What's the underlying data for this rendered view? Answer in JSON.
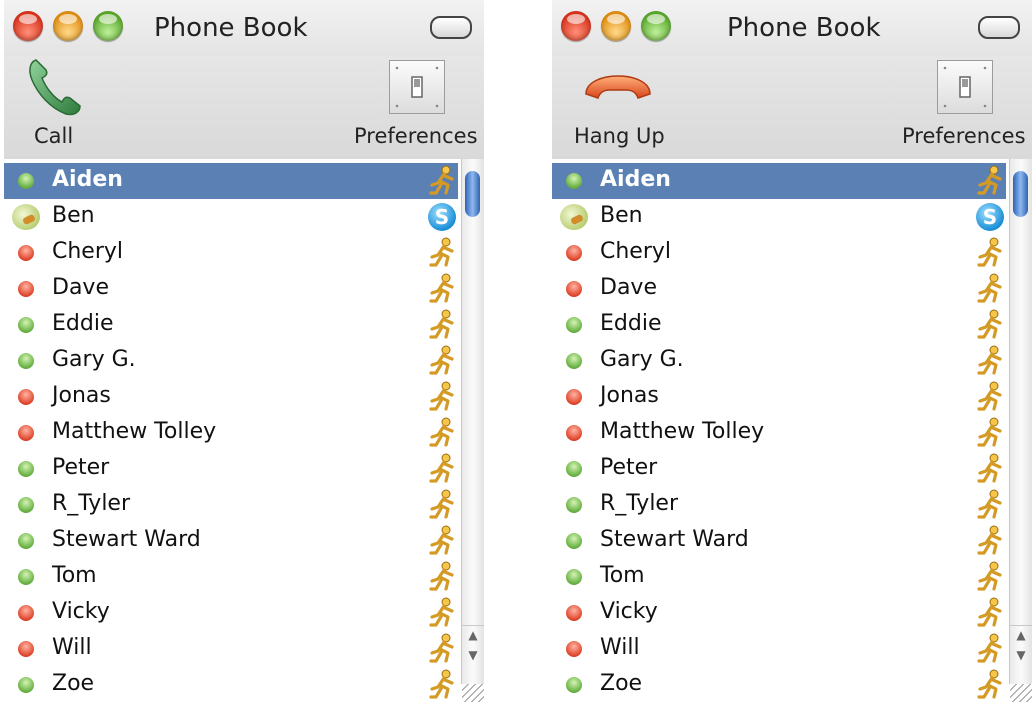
{
  "windows": [
    {
      "title": "Phone Book",
      "call_label": "Call",
      "call_icon": "phone-handset-icon",
      "preferences_label": "Preferences",
      "contacts": [
        {
          "name": "Aiden",
          "status": "green",
          "service": "aim",
          "selected": true
        },
        {
          "name": "Ben",
          "status": "phone",
          "service": "skype"
        },
        {
          "name": "Cheryl",
          "status": "red",
          "service": "aim"
        },
        {
          "name": "Dave",
          "status": "red",
          "service": "aim"
        },
        {
          "name": "Eddie",
          "status": "green",
          "service": "aim"
        },
        {
          "name": "Gary G.",
          "status": "green",
          "service": "aim"
        },
        {
          "name": "Jonas",
          "status": "red",
          "service": "aim"
        },
        {
          "name": "Matthew Tolley",
          "status": "red",
          "service": "aim"
        },
        {
          "name": "Peter",
          "status": "green",
          "service": "aim"
        },
        {
          "name": "R_Tyler",
          "status": "green",
          "service": "aim"
        },
        {
          "name": "Stewart Ward",
          "status": "green",
          "service": "aim"
        },
        {
          "name": "Tom",
          "status": "green",
          "service": "aim"
        },
        {
          "name": "Vicky",
          "status": "red",
          "service": "aim"
        },
        {
          "name": "Will",
          "status": "red",
          "service": "aim"
        },
        {
          "name": "Zoe",
          "status": "green",
          "service": "aim"
        }
      ]
    },
    {
      "title": "Phone Book",
      "call_label": "Hang Up",
      "call_icon": "hang-up-icon",
      "preferences_label": "Preferences",
      "contacts": [
        {
          "name": "Aiden",
          "status": "green",
          "service": "aim",
          "selected": true
        },
        {
          "name": "Ben",
          "status": "phone",
          "service": "skype"
        },
        {
          "name": "Cheryl",
          "status": "red",
          "service": "aim"
        },
        {
          "name": "Dave",
          "status": "red",
          "service": "aim"
        },
        {
          "name": "Eddie",
          "status": "green",
          "service": "aim"
        },
        {
          "name": "Gary G.",
          "status": "green",
          "service": "aim"
        },
        {
          "name": "Jonas",
          "status": "red",
          "service": "aim"
        },
        {
          "name": "Matthew Tolley",
          "status": "red",
          "service": "aim"
        },
        {
          "name": "Peter",
          "status": "green",
          "service": "aim"
        },
        {
          "name": "R_Tyler",
          "status": "green",
          "service": "aim"
        },
        {
          "name": "Stewart Ward",
          "status": "green",
          "service": "aim"
        },
        {
          "name": "Tom",
          "status": "green",
          "service": "aim"
        },
        {
          "name": "Vicky",
          "status": "red",
          "service": "aim"
        },
        {
          "name": "Will",
          "status": "red",
          "service": "aim"
        },
        {
          "name": "Zoe",
          "status": "green",
          "service": "aim"
        }
      ]
    }
  ],
  "colors": {
    "selection": "#5b80b3",
    "online": "#6cb447",
    "offline": "#e24b32",
    "call_green": "#4f9a5a",
    "hangup_orange": "#e8662e"
  },
  "skype_letter": "S"
}
